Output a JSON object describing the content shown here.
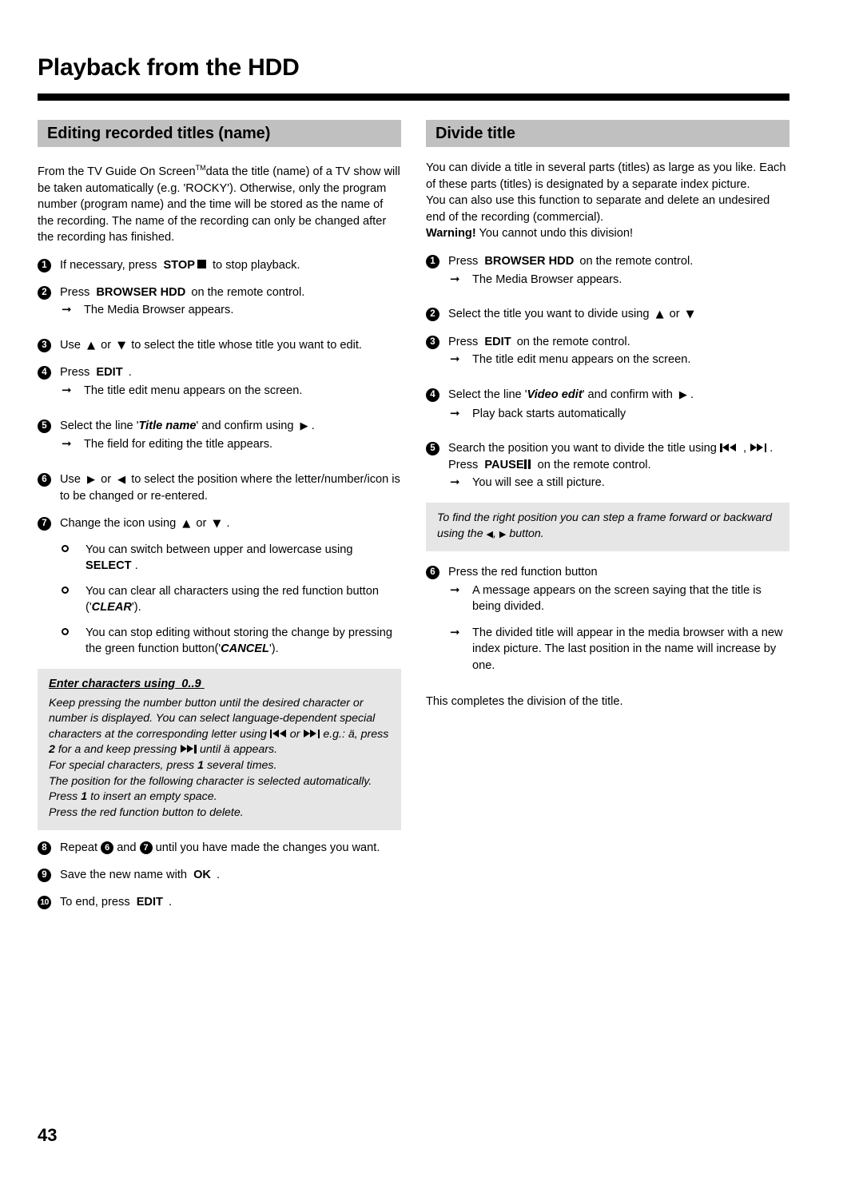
{
  "page": {
    "title": "Playback from the HDD",
    "number": "43"
  },
  "left_column": {
    "section_title": "Editing recorded titles (name)",
    "intro": {
      "line1_a": "From the TV Guide On Screen",
      "line1_tm": "TM",
      "line1_b": "data the title (name) of a TV show will be taken automatically (e.g. 'ROCKY'). Otherwise, only the program number (program name) and the time will be stored as the name of the recording. The name of the recording can only be changed after the recording has finished."
    },
    "steps": [
      {
        "num": "1",
        "text_a": "If necessary, press",
        "key": "STOP",
        "icon": "stop-square-icon",
        "text_b": "to stop playback."
      },
      {
        "num": "2",
        "text_a": "Press",
        "key": "BROWSER HDD",
        "text_b": "on the remote control.",
        "result": "The Media Browser appears."
      },
      {
        "num": "3",
        "text_a": "Use",
        "icon_up": "up-arrow-icon",
        "text_or": "or",
        "icon_down": "down-arrow-icon",
        "text_b": "to select the title whose title you want to edit."
      },
      {
        "num": "4",
        "text_a": "Press",
        "key": "EDIT",
        "text_b": ".",
        "result": "The title edit menu appears on the screen."
      },
      {
        "num": "5",
        "text_a": "Select the line '",
        "emphasis": "Title name",
        "text_b": "' and confirm using",
        "icon_right": "right-arrow-icon",
        "text_c": ".",
        "result": "The field for editing the title appears."
      },
      {
        "num": "6",
        "text_a": "Use",
        "icon_right": "right-arrow-icon",
        "text_or": "or",
        "icon_left": "left-arrow-icon",
        "text_b": "to select the position where the letter/number/icon is to be changed or re-entered."
      },
      {
        "num": "7",
        "text_a": "Change the icon using",
        "icon_up": "up-arrow-icon",
        "text_or": "or",
        "icon_down": "down-arrow-icon",
        "text_b": "."
      }
    ],
    "bullets": [
      {
        "text_a": "You can switch between upper and lowercase using",
        "key": "SELECT",
        "text_b": "."
      },
      {
        "text_a": "You can clear all characters using the red function button ('",
        "key": "CLEAR",
        "text_b": "')."
      },
      {
        "text_a": "You can stop editing without storing the change by pressing the green function button('",
        "key": "CANCEL",
        "text_b": "')."
      }
    ],
    "note": {
      "title_a": "Enter characters using",
      "title_key": "0..9",
      "line1_a": "Keep pressing the number button until the desired character or number is displayed. You can select language-dependent special characters at the corresponding letter using",
      "icon_back": "skip-back-icon",
      "line1_or": "or",
      "icon_fwd": "skip-forward-icon",
      "line1_b": "e.g.: ä, press",
      "key2": "2",
      "line1_c": "for a and keep pressing",
      "icon_fwd2": "skip-forward-icon",
      "line1_d": "until ä appears.",
      "line2_a": "For special characters, press",
      "key1": "1",
      "line2_b": "several times.",
      "line3": "The position for the following character is selected automatically.",
      "line4_a": "Press",
      "key1b": "1",
      "line4_b": "to insert an empty space.",
      "line5": "Press the red function button to delete."
    },
    "steps_end": [
      {
        "num": "8",
        "text_a": "Repeat",
        "ref1": "6",
        "text_and": "and",
        "ref2": "7",
        "text_b": "until you have made the changes you want."
      },
      {
        "num": "9",
        "text_a": "Save the new name with",
        "key": "OK",
        "text_b": "."
      },
      {
        "num": "10",
        "text_a": "To end, press",
        "key": "EDIT",
        "text_b": "."
      }
    ]
  },
  "right_column": {
    "section_title": "Divide title",
    "intro": {
      "line1": "You can divide a title in several parts (titles) as large as you like. Each of these parts (titles) is designated by a separate index picture.",
      "line2": "You can also use this function to separate and delete an undesired end of the recording (commercial).",
      "warning_label": "Warning!",
      "warning_text": "You cannot undo this division!"
    },
    "steps": [
      {
        "num": "1",
        "text_a": "Press",
        "key": "BROWSER HDD",
        "text_b": "on the remote control.",
        "result": "The Media Browser appears."
      },
      {
        "num": "2",
        "text_a": "Select the title you want to divide using",
        "icon_up": "up-arrow-icon",
        "text_or": "or",
        "icon_down": "down-arrow-icon"
      },
      {
        "num": "3",
        "text_a": "Press",
        "key": "EDIT",
        "text_b": "on the remote control.",
        "result": "The title edit menu appears on the screen."
      },
      {
        "num": "4",
        "text_a": "Select the line '",
        "emphasis": "Video edit",
        "text_b": "' and confirm with",
        "icon_right": "right-arrow-icon",
        "text_c": ".",
        "result": "Play back starts automatically"
      },
      {
        "num": "5",
        "text_a": "Search the position you want to divide the title using",
        "icon_back": "skip-back-icon",
        "text_comma": ",",
        "icon_fwd": "skip-forward-icon",
        "text_b": ".",
        "line2_a": "Press",
        "key": "PAUSE",
        "icon_pause": "pause-icon",
        "line2_b": "on the remote control.",
        "result": "You will see a still picture."
      }
    ],
    "tip": {
      "text_a": "To find the right position you can step a frame forward or backward using the",
      "icon_left": "left-arrow-icon",
      "text_comma": ",",
      "icon_right": "right-arrow-icon",
      "text_b": "button."
    },
    "step6": {
      "num": "6",
      "text": "Press the red function button",
      "result1": "A message appears on the screen saying that the title is being divided.",
      "result2": "The divided title will appear in the media browser with a new index picture. The last position in the name will increase by one."
    },
    "closing": "This completes the division of the title."
  }
}
